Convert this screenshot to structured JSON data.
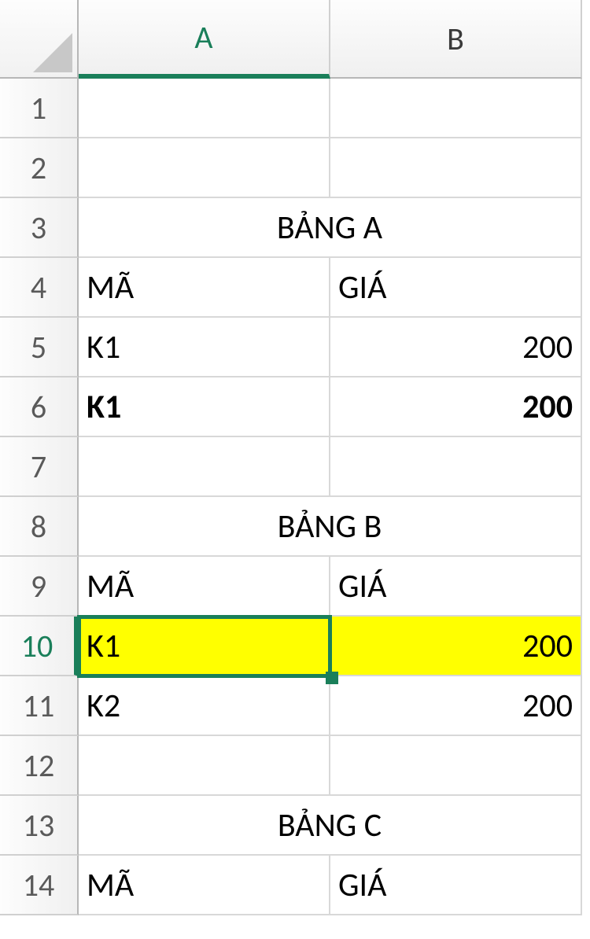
{
  "columns": [
    "A",
    "B"
  ],
  "rows": [
    "1",
    "2",
    "3",
    "4",
    "5",
    "6",
    "7",
    "8",
    "9",
    "10",
    "11",
    "12",
    "13",
    "14"
  ],
  "selected": {
    "col": "A",
    "rowLabel": "10"
  },
  "cells": {
    "r3_merged": "BẢNG A",
    "r4a": "MÃ",
    "r4b": "GIÁ",
    "r5a": "K1",
    "r5b": "200",
    "r6a": "K1",
    "r6b": "200",
    "r8_merged": "BẢNG B",
    "r9a": "MÃ",
    "r9b": "GIÁ",
    "r10a": "K1",
    "r10b": "200",
    "r11a": "K2",
    "r11b": "200",
    "r13_merged": "BẢNG C",
    "r14a": "MÃ",
    "r14b": "GIÁ"
  }
}
